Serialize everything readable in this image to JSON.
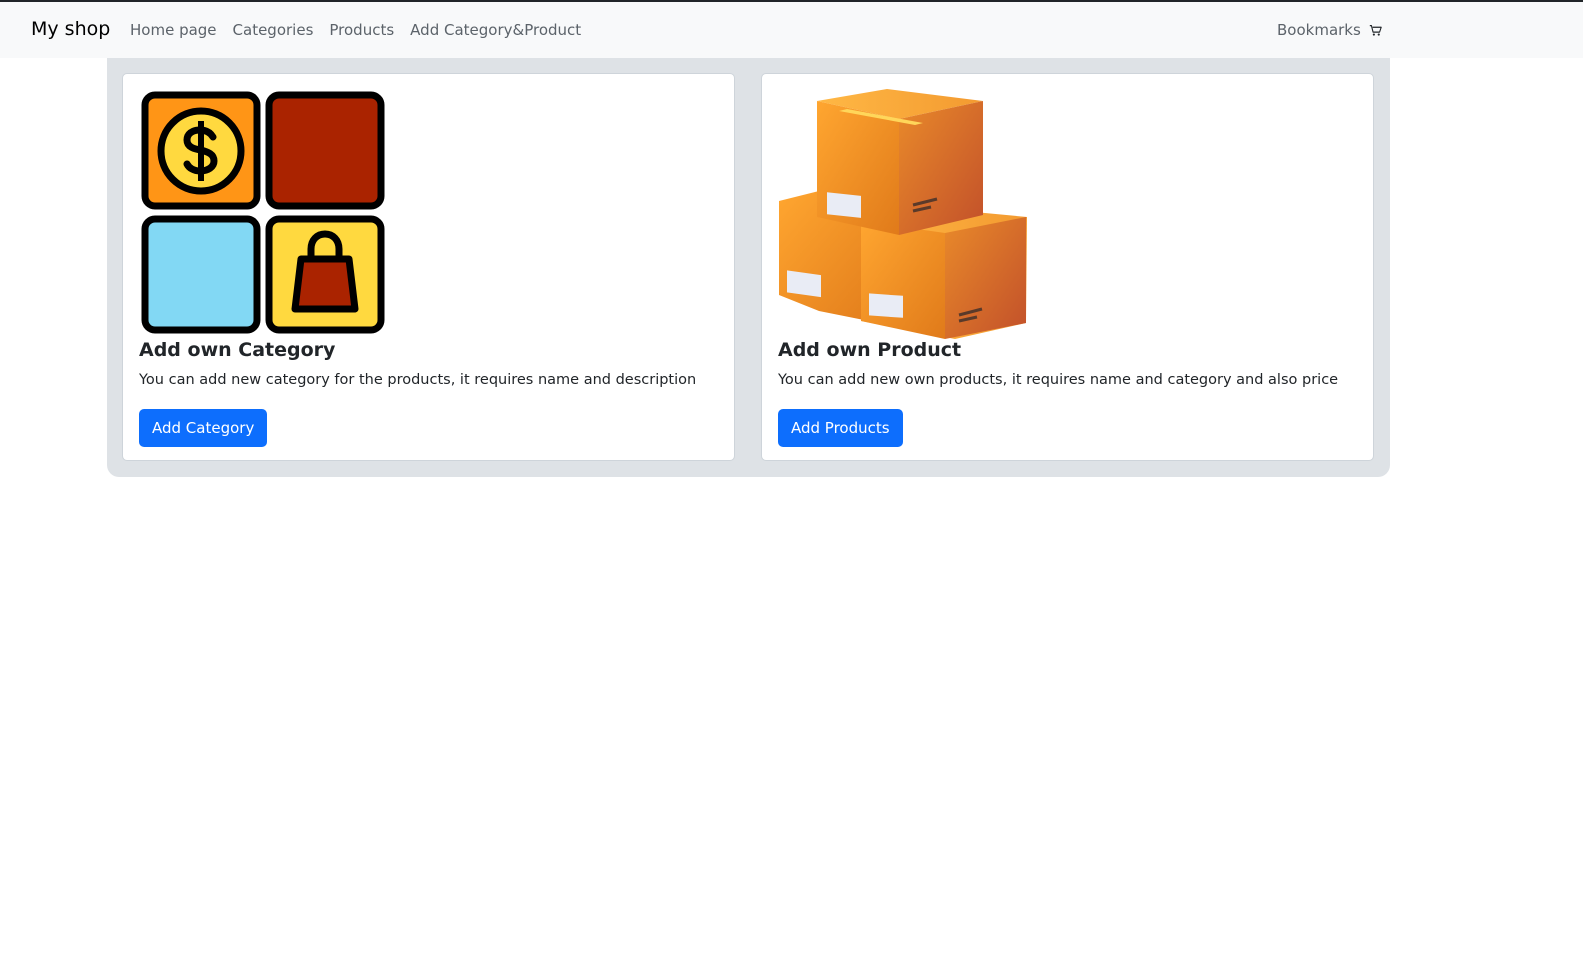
{
  "navbar": {
    "brand": "My shop",
    "links": [
      "Home page",
      "Categories",
      "Products",
      "Add Category&Product"
    ],
    "bookmarks_label": "Bookmarks",
    "cart_icon": "cart-icon"
  },
  "cards": [
    {
      "image_icon": "category-grid-icon",
      "title": "Add own Category",
      "text": "You can add new category for the products, it requires name and description",
      "button_label": "Add Category"
    },
    {
      "image_icon": "boxes-icon",
      "title": "Add own Product",
      "text": "You can add new own products, it requires name and category and also price",
      "button_label": "Add Products"
    }
  ],
  "colors": {
    "primary": "#0d6efd",
    "navbar_bg": "#f8f9fa",
    "panel_bg": "#dee2e6"
  }
}
